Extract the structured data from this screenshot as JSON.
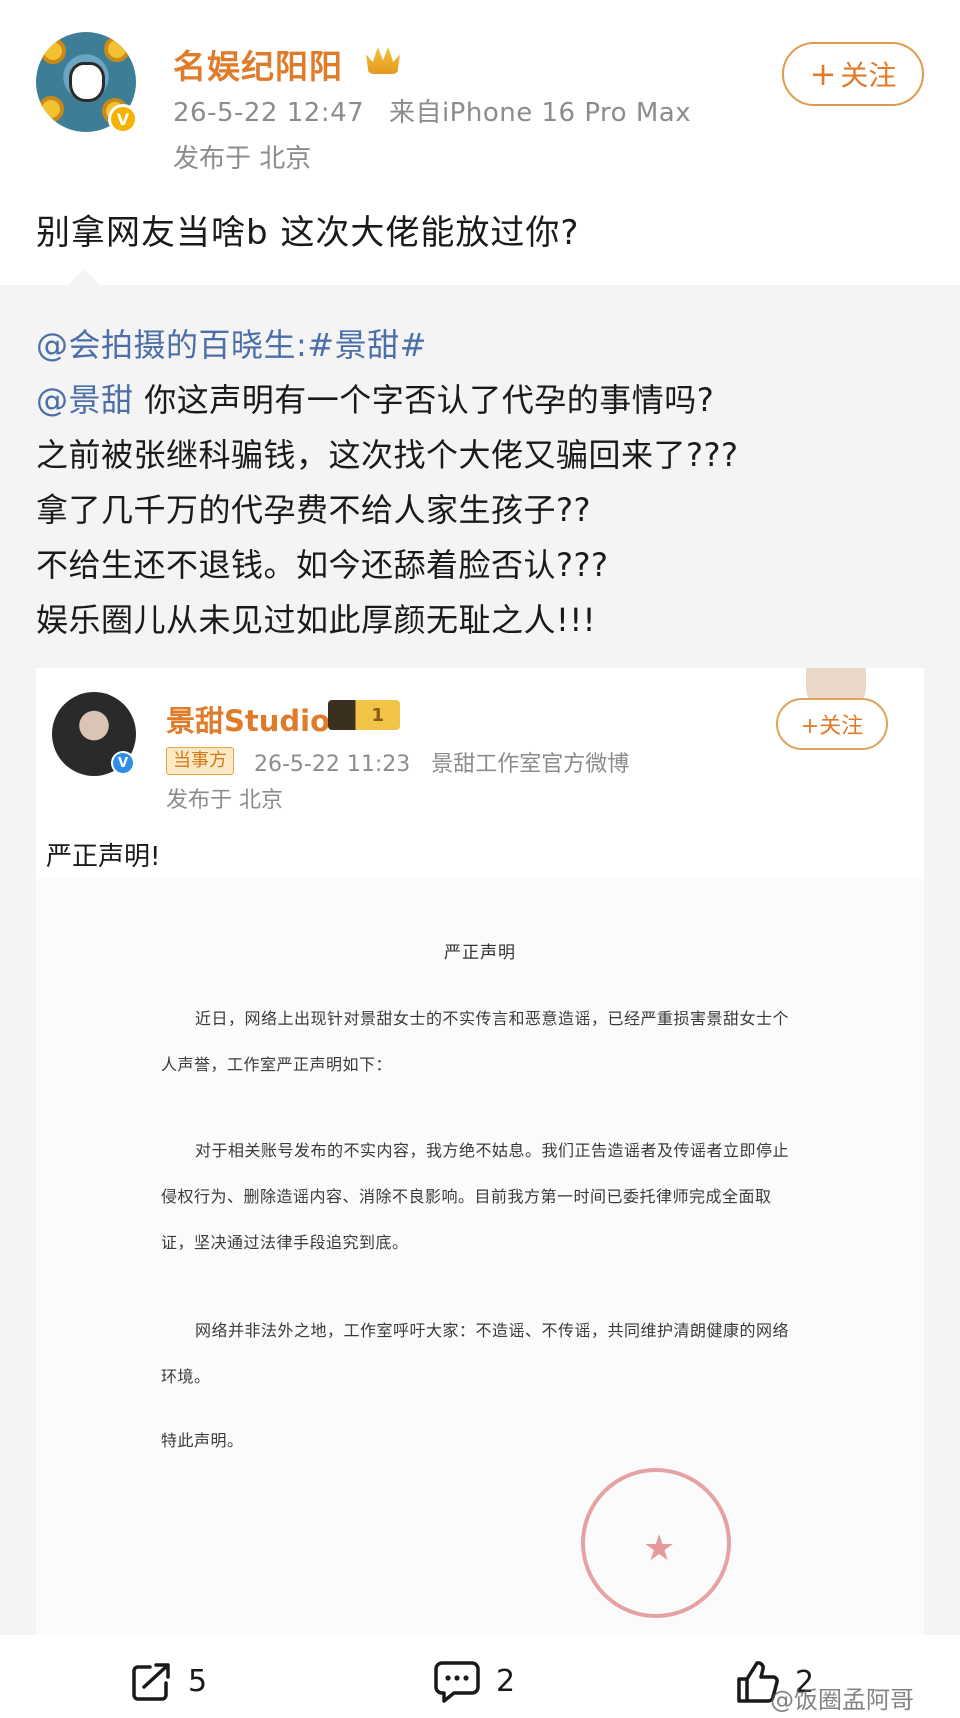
{
  "post": {
    "username": "名娱纪阳阳",
    "time": "26-5-22 12:47",
    "source": "来自iPhone 16 Pro Max",
    "location": "发布于 北京",
    "follow_label": "关注",
    "text": "别拿网友当啥b 这次大佬能放过你?"
  },
  "repost": {
    "mention_line_user": "@会拍摄的百晓生:",
    "mention_line_tag": "#景甜#",
    "line2_user": "@景甜",
    "line2_text": " 你这声明有一个字否认了代孕的事情吗?",
    "line3": "之前被张继科骗钱，这次找个大佬又骗回来了???",
    "line4": "拿了几千万的代孕费不给人家生孩子??",
    "line5": "不给生还不退钱。如今还舔着脸否认???",
    "line6": "娱乐圈儿从未见过如此厚颜无耻之人!!!"
  },
  "embed": {
    "name": "景甜Studio",
    "vip_level": "1",
    "badge": "当事方",
    "time": "26-5-22 11:23",
    "source": "景甜工作室官方微博",
    "location": "发布于 北京",
    "follow_label": "+关注",
    "text": "严正声明!",
    "doc": {
      "title": "严正声明",
      "p1": "近日，网络上出现针对景甜女士的不实传言和恶意造谣，已经严重损害景甜女士个人声誉，工作室严正声明如下：",
      "p2": "对于相关账号发布的不实内容，我方绝不姑息。我们正告造谣者及传谣者立即停止侵权行为、删除造谣内容、消除不良影响。目前我方第一时间已委托律师完成全面取证，坚决通过法律手段追究到底。",
      "p3": "网络并非法外之地，工作室呼吁大家：不造谣、不传谣，共同维护清朗健康的网络环境。",
      "p4": "特此声明。"
    }
  },
  "actions": {
    "repost_count": "5",
    "comment_count": "2",
    "like_count": "2"
  },
  "watermark": "@饭圈孟阿哥",
  "colors": {
    "username": "#e07b2a",
    "link": "#4d6fa8",
    "meta": "#8c8c8c",
    "repost_bg": "#f4f4f4"
  }
}
